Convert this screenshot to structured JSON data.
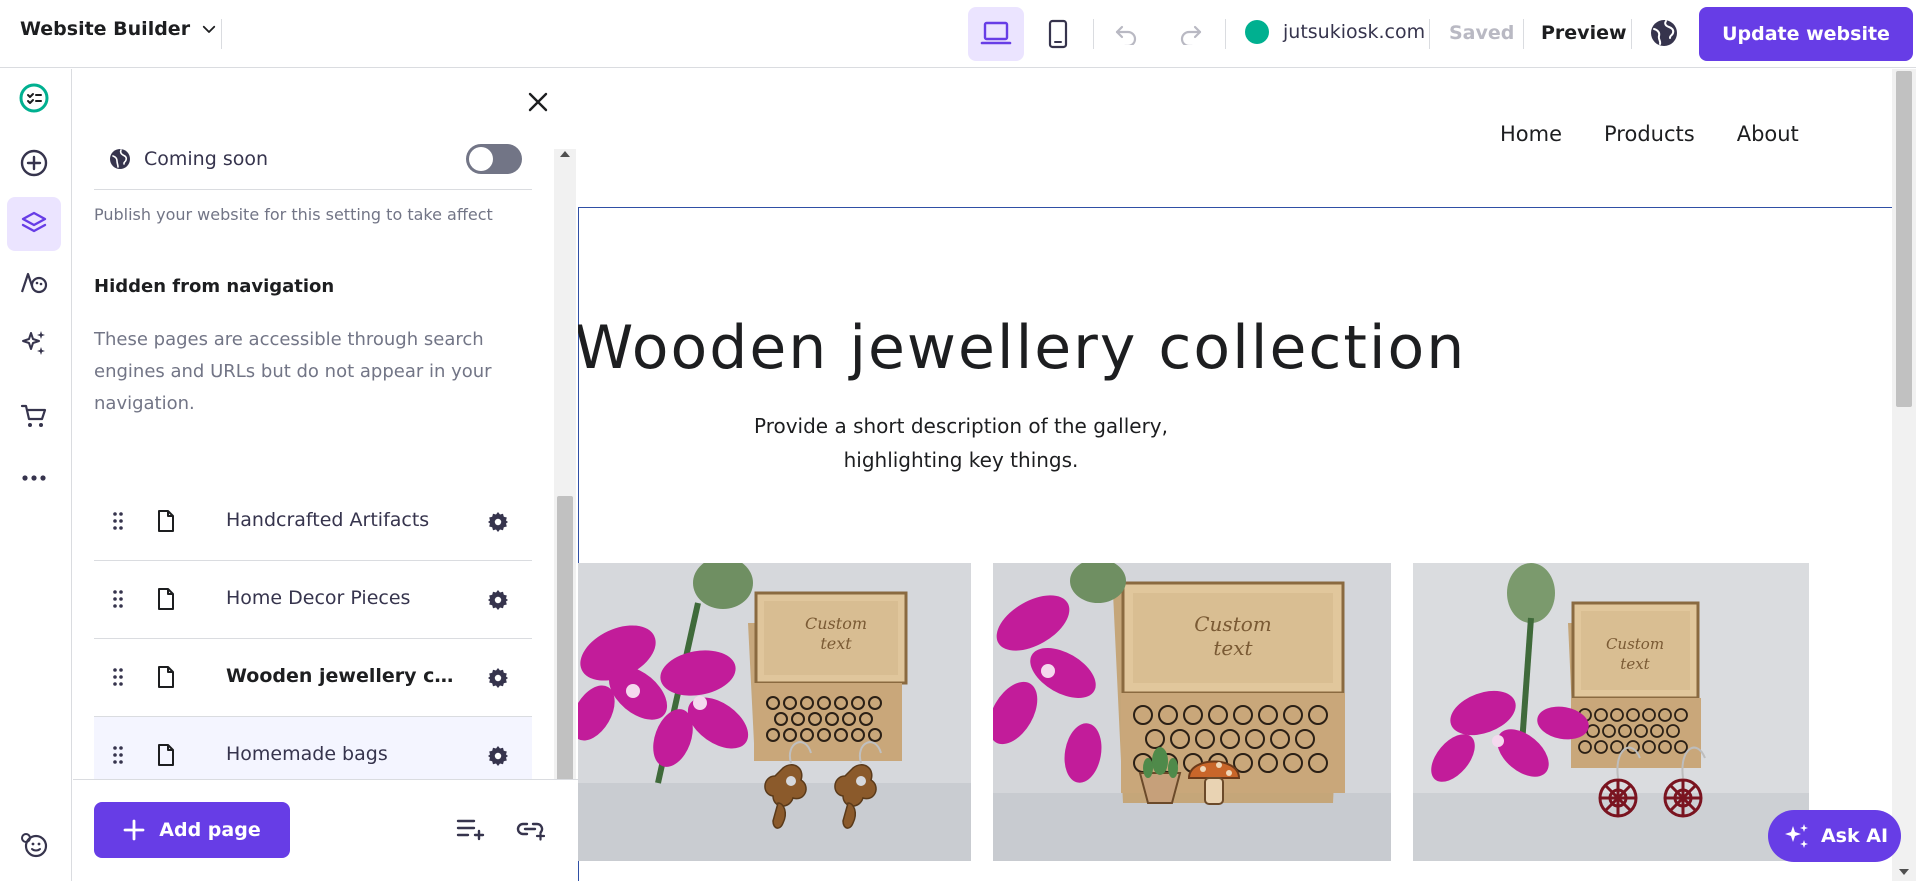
{
  "topbar": {
    "app_name": "Website Builder",
    "domain": "jutsukiosk.com",
    "saved_label": "Saved",
    "preview_label": "Preview",
    "update_label": "Update website"
  },
  "panel": {
    "coming_soon_label": "Coming soon",
    "coming_soon_enabled": false,
    "publish_note": "Publish your website for this setting to take affect",
    "hidden_title": "Hidden from navigation",
    "hidden_desc": "These pages are accessible through search engines and URLs but do not appear in your navigation.",
    "pages": [
      {
        "label": "Handcrafted Artifacts",
        "bold": false
      },
      {
        "label": "Home Decor Pieces",
        "bold": false
      },
      {
        "label": "Wooden jewellery collec...",
        "bold": true
      },
      {
        "label": "Homemade bags",
        "bold": false
      }
    ],
    "add_page_label": "Add page"
  },
  "site": {
    "nav": [
      "Home",
      "Products",
      "About"
    ],
    "hero_title": "Wooden jewellery collection",
    "hero_desc": "Provide a short description of the gallery, highlighting key things.",
    "gallery": [
      {
        "box_text": "Custom text"
      },
      {
        "box_text": "Custom text"
      },
      {
        "box_text": "Custom text"
      }
    ]
  },
  "ask_ai_label": "Ask AI",
  "colors": {
    "accent": "#673de6",
    "accent_light": "#ebe4ff",
    "domain_status": "#00b090",
    "selection_frame": "#2f4fa5"
  }
}
